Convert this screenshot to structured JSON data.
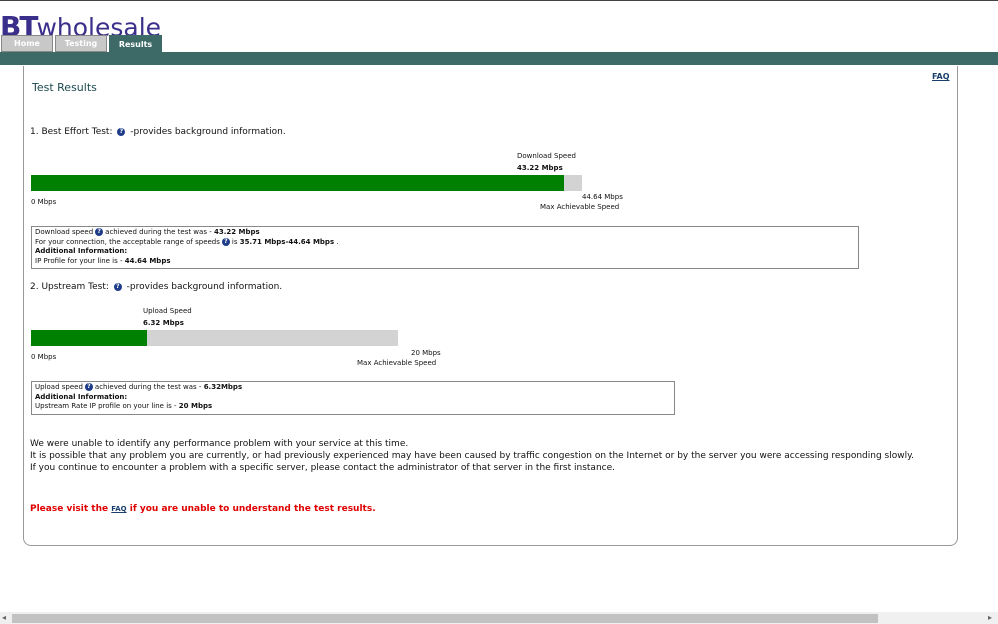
{
  "header": {
    "logo_bt": "BT",
    "logo_text": "wholesale",
    "tabs": [
      {
        "label": "Home"
      },
      {
        "label": "Testing"
      },
      {
        "label": "Results"
      }
    ]
  },
  "panel": {
    "faq_link": "FAQ",
    "title": "Test Results"
  },
  "best_effort": {
    "heading_prefix": "1. Best Effort Test:",
    "heading_suffix": "-provides background information.",
    "marker_label": "Download Speed",
    "marker_value": "43.22 Mbps",
    "axis_min": "0 Mbps",
    "axis_max": "44.64 Mbps",
    "axis_max_label": "Max Achievable Speed",
    "fill_fraction": 0.968,
    "info": {
      "line1_prefix": "Download speed",
      "line1_mid": "achieved during the test was -",
      "line1_value": "43.22 Mbps",
      "line2_prefix": "For your connection, the acceptable range of speeds",
      "line2_mid": "is",
      "line2_value": "35.71 Mbps-44.64 Mbps",
      "line2_end": ".",
      "line3": "Additional Information:",
      "line4_prefix": "IP Profile for your line is -",
      "line4_value": "44.64 Mbps"
    }
  },
  "upstream": {
    "heading_prefix": "2. Upstream Test:",
    "heading_suffix": "-provides background information.",
    "marker_label": "Upload Speed",
    "marker_value": "6.32 Mbps",
    "axis_min": "0 Mbps",
    "axis_max": "20 Mbps",
    "axis_max_label": "Max Achievable Speed",
    "fill_fraction": 0.316,
    "info": {
      "line1_prefix": "Upload speed",
      "line1_mid": "achieved during the test was -",
      "line1_value": "6.32Mbps",
      "line2": "Additional Information:",
      "line3_prefix": "Upstream Rate IP profile on your line is -",
      "line3_value": "20 Mbps"
    }
  },
  "message": {
    "line1": "We were unable to identify any performance problem with your service at this time.",
    "line2": "It is possible that any problem you are currently, or had previously experienced may have been caused by traffic congestion on the Internet or by the server you were accessing responding slowly.",
    "line3": "If you continue to encounter a problem with a specific server, please contact the administrator of that server in the first instance."
  },
  "please": {
    "prefix": "Please visit the",
    "link": "FAQ",
    "suffix": "if you are unable to understand the test results."
  },
  "colors": {
    "accent": "#3d6a67",
    "bar_fill": "#008000",
    "bar_bg": "#d3d3d3",
    "alert": "#e00000"
  },
  "icons": {
    "help": "help-question-icon"
  }
}
